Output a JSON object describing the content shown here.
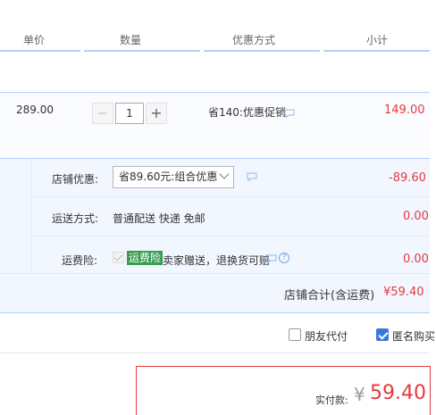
{
  "header": {
    "col_unit_price": "单价",
    "col_quantity": "数量",
    "col_promo": "优惠方式",
    "col_subtotal": "小计"
  },
  "item": {
    "unit_price": "289.00",
    "quantity": "1",
    "minus_label": "−",
    "plus_label": "+",
    "promo_text": "省140:优惠促销",
    "subtotal": "149.00"
  },
  "shop": {
    "discount_label": "店铺优惠:",
    "discount_select_value": "省89.60元:组合优惠",
    "discount_amount": "-89.60",
    "shipping_label": "运送方式:",
    "shipping_value": "普通配送 快递 免邮",
    "shipping_amount": "0.00",
    "insurance_label": "运费险:",
    "insurance_tag": "运费险",
    "insurance_text": "卖家赠送，退换货可赔",
    "insurance_amount": "0.00",
    "help_icon_text": "?",
    "total_label": "店铺合计(含运费)",
    "total_value": "¥59.40"
  },
  "options": {
    "friend_pay_label": "朋友代付",
    "friend_pay_checked": false,
    "anonymous_label": "匿名购买",
    "anonymous_checked": true
  },
  "payment": {
    "label": "实付款:",
    "currency": "¥",
    "amount": "59.40"
  },
  "colors": {
    "price_red": "#e4393c",
    "header_line": "#b2d1ff",
    "shop_bg": "#f2f7ff",
    "tag_green": "#3a9b52",
    "accent_blue": "#3c78d8"
  },
  "icons": [
    "chat-bubble-icon",
    "help-circle-icon",
    "minus-icon",
    "plus-icon",
    "chevron-down-icon",
    "checkbox-icon"
  ]
}
